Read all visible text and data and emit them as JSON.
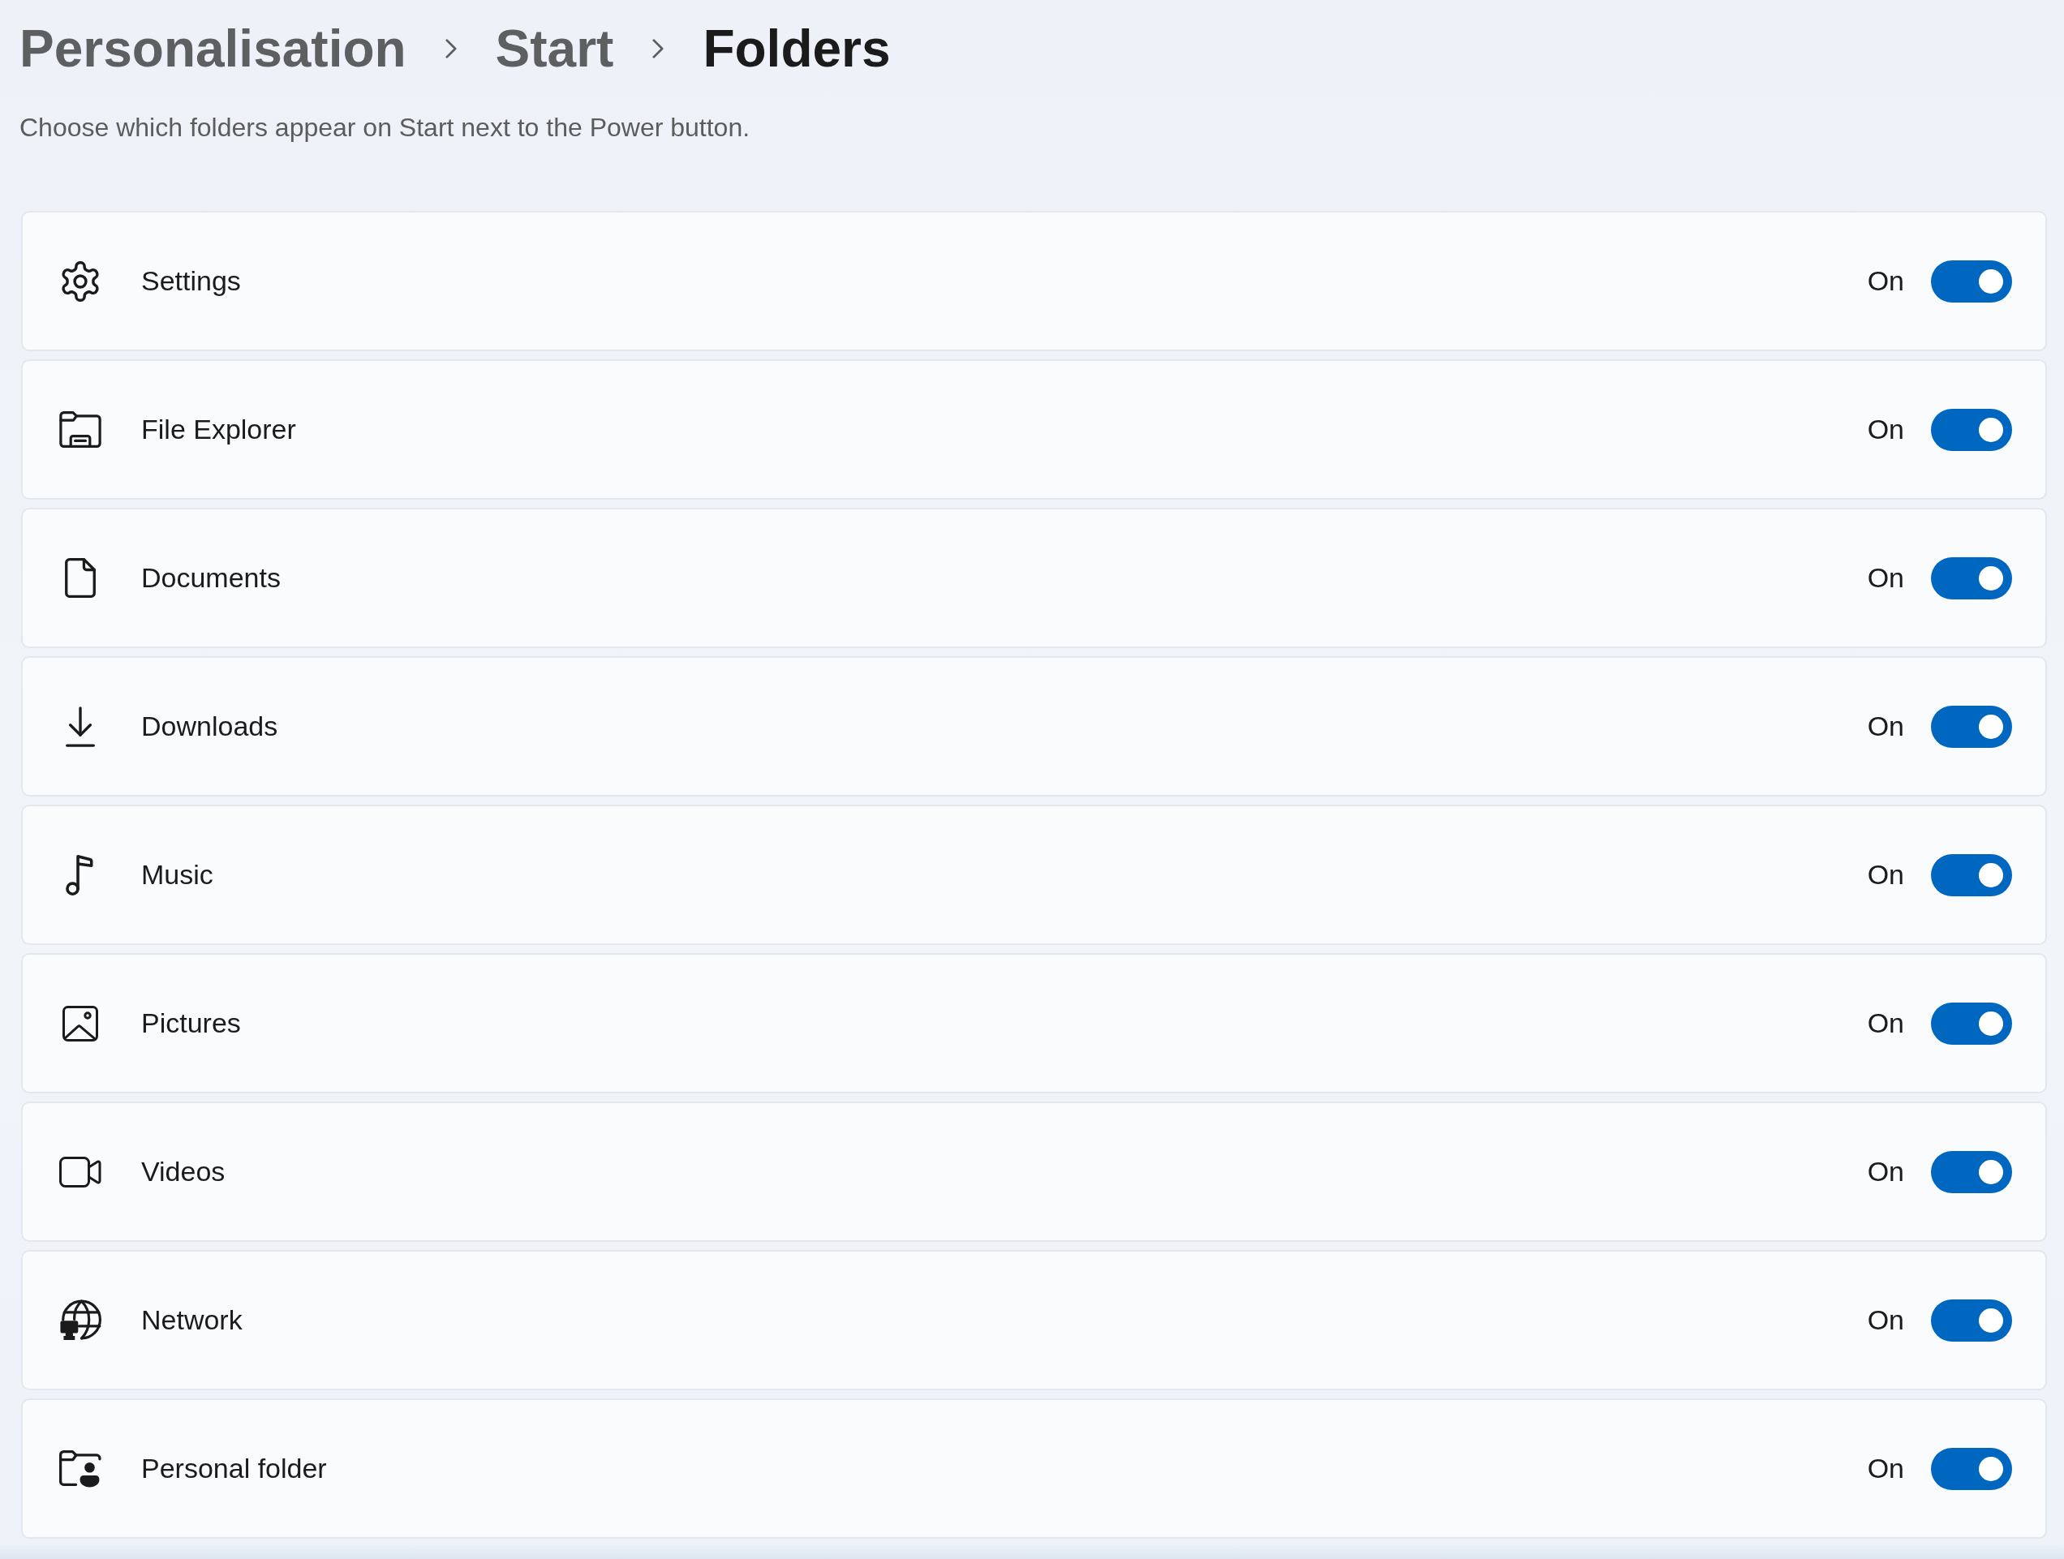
{
  "breadcrumb": [
    {
      "label": "Personalisation",
      "current": false
    },
    {
      "label": "Start",
      "current": false
    },
    {
      "label": "Folders",
      "current": true
    }
  ],
  "description": "Choose which folders appear on Start next to the Power button.",
  "folders": [
    {
      "kind": "settings",
      "label": "Settings",
      "status": "On",
      "on": true
    },
    {
      "kind": "explorer",
      "label": "File Explorer",
      "status": "On",
      "on": true
    },
    {
      "kind": "documents",
      "label": "Documents",
      "status": "On",
      "on": true
    },
    {
      "kind": "downloads",
      "label": "Downloads",
      "status": "On",
      "on": true
    },
    {
      "kind": "music",
      "label": "Music",
      "status": "On",
      "on": true
    },
    {
      "kind": "pictures",
      "label": "Pictures",
      "status": "On",
      "on": true
    },
    {
      "kind": "videos",
      "label": "Videos",
      "status": "On",
      "on": true
    },
    {
      "kind": "network",
      "label": "Network",
      "status": "On",
      "on": true
    },
    {
      "kind": "personal",
      "label": "Personal folder",
      "status": "On",
      "on": true
    }
  ]
}
